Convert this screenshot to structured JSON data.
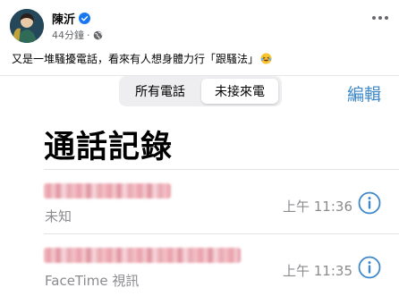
{
  "post": {
    "author": "陳沂",
    "time": "44分鐘",
    "separator": "·",
    "caption": "又是一堆騷擾電話，看來有人想身體力行「跟騷法」",
    "colors": {
      "verified": "#1877f2",
      "meta": "#65676b"
    },
    "icons": {
      "verified": "verified-badge-icon",
      "audience": "globe-icon",
      "more": "more-options-icon",
      "emoji": "laughing-emoji-icon"
    }
  },
  "phone": {
    "segments": [
      "所有電話",
      "未接來電"
    ],
    "selected_segment": "未接來電",
    "edit_label": "編輯",
    "title": "通話記錄",
    "calls": [
      {
        "number_blurred": true,
        "type": "未知",
        "time": "上午 11:36"
      },
      {
        "number_blurred": true,
        "type": "FaceTime 視訊",
        "time": "上午 11:35"
      }
    ],
    "colors": {
      "accent": "#3e88c8",
      "missed_number": "#e57f8f",
      "secondary_text": "#8b8b8f"
    },
    "icons": {
      "info": "info-icon"
    }
  }
}
